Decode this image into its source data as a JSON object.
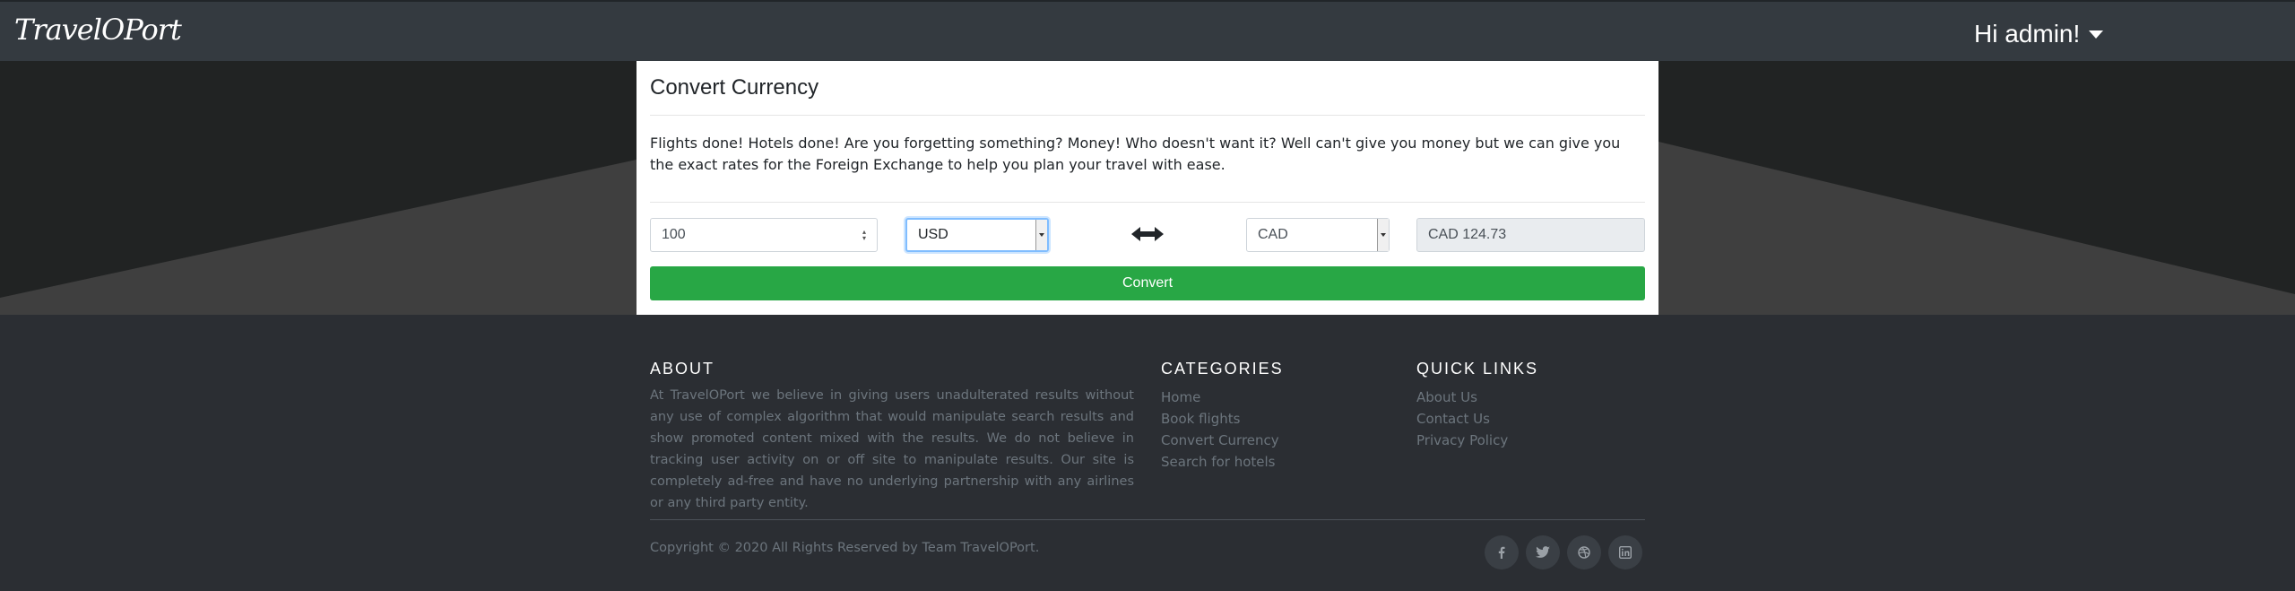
{
  "navbar": {
    "brand": "TravelOPort",
    "user_greeting": "Hi admin!"
  },
  "converter": {
    "title": "Convert Currency",
    "description": "Flights done! Hotels done! Are you forgetting something? Money! Who doesn't want it? Well can't give you money but we can give you the exact rates for the Foreign Exchange to help you plan your travel with ease.",
    "amount_value": "100",
    "from_currency": "USD",
    "to_currency": "CAD",
    "result_value": "CAD 124.73",
    "convert_label": "Convert"
  },
  "footer": {
    "about_heading": "ABOUT",
    "about_text": "At TravelOPort we believe in giving users unadulterated results without any use of complex algorithm that would manipulate search results and show promoted content mixed with the results. We do not believe in tracking user activity on or off site to manipulate results. Our site is completely ad-free and have no underlying partnership with any airlines or any third party entity.",
    "categories_heading": "CATEGORIES",
    "categories": [
      "Home",
      "Book flights",
      "Convert Currency",
      "Search for hotels"
    ],
    "quicklinks_heading": "QUICK LINKS",
    "quicklinks": [
      "About Us",
      "Contact Us",
      "Privacy Policy"
    ],
    "copyright": "Copyright © 2020 All Rights Reserved by Team TravelOPort.",
    "social_icons": [
      "facebook-icon",
      "twitter-icon",
      "dribbble-icon",
      "linkedin-icon"
    ]
  },
  "colors": {
    "navbar_bg": "#343a40",
    "convert_button": "#28a745",
    "footer_bg": "#2b2e33"
  }
}
